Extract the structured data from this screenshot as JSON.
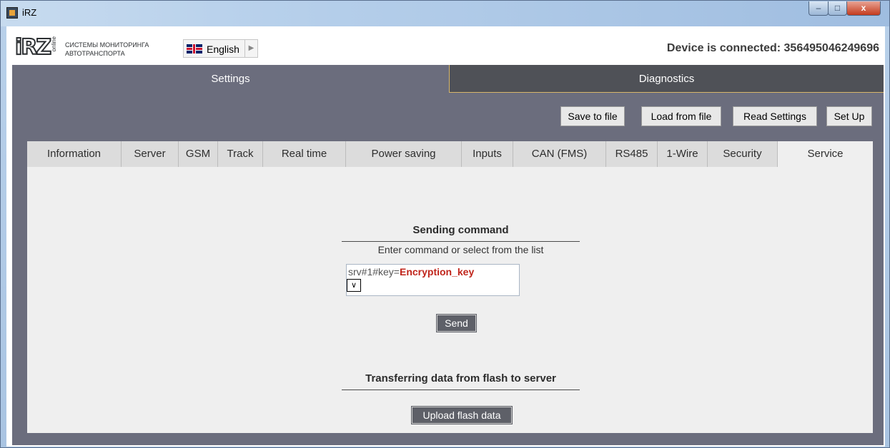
{
  "window": {
    "title": "iRZ",
    "controls": {
      "minimize": "–",
      "maximize": "□",
      "close": "x"
    }
  },
  "header": {
    "logo_text": "iRZ",
    "logo_sub": "online",
    "tagline_line1": "СИСТЕМЫ МОНИТОРИНГА",
    "tagline_line2": "АВТОТРАНСПОРТА",
    "language": "English",
    "device_status": "Device is connected: 356495046249696"
  },
  "main_tabs": [
    {
      "label": "Settings",
      "active": true
    },
    {
      "label": "Diagnostics",
      "active": false
    }
  ],
  "toolbar": {
    "save_to_file": "Save to file",
    "load_from_file": "Load from file",
    "read_settings": "Read Settings",
    "set_up": "Set Up"
  },
  "sub_tabs": [
    {
      "label": "Information",
      "active": false
    },
    {
      "label": "Server",
      "active": false
    },
    {
      "label": "GSM",
      "active": false
    },
    {
      "label": "Track",
      "active": false
    },
    {
      "label": "Real time",
      "active": false
    },
    {
      "label": "Power saving",
      "active": false
    },
    {
      "label": "Inputs",
      "active": false
    },
    {
      "label": "CAN (FMS)",
      "active": false
    },
    {
      "label": "RS485",
      "active": false
    },
    {
      "label": "1-Wire",
      "active": false
    },
    {
      "label": "Security",
      "active": false
    },
    {
      "label": "Service",
      "active": true
    }
  ],
  "service": {
    "sending_title": "Sending command",
    "hint": "Enter command or select from the list",
    "command_prefix": "srv#1#key=",
    "command_key": "Encryption_key",
    "dropdown_glyph": "∨",
    "send_label": "Send",
    "transfer_title": "Transferring data from flash to server",
    "upload_label": "Upload flash data"
  },
  "colors": {
    "shell": "#6b6d7d",
    "active_tab_border": "#d7b66b",
    "command_key": "#c0251b"
  }
}
